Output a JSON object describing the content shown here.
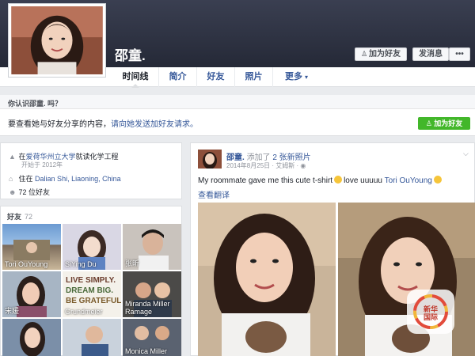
{
  "profile": {
    "name": "邵童."
  },
  "cover_actions": {
    "add_friend": "加为好友",
    "message": "发消息",
    "more": "•••"
  },
  "tabs": [
    {
      "label": "时间线"
    },
    {
      "label": "简介"
    },
    {
      "label": "好友"
    },
    {
      "label": "照片"
    },
    {
      "label": "更多"
    }
  ],
  "know_banner": "你认识邵童. 吗？",
  "share_prompt": {
    "text": "要查看她与好友分享的内容，",
    "link": "请向她发送加好友请求。",
    "button": "加为好友"
  },
  "intro": {
    "study_prefix": "在",
    "school": "爱荷华州立大学",
    "study_suffix": "就读化学工程",
    "since": "开始于 2012年",
    "lives_prefix": "住在",
    "city": "Dalian Shi, Liaoning, China",
    "friends_count": "72 位好友"
  },
  "friends": {
    "title": "好友",
    "count": "72",
    "tiles": [
      {
        "name": "Tori OuYoung"
      },
      {
        "name": "SiYing Du"
      },
      {
        "name": "张昕"
      },
      {
        "name": "宋媛"
      },
      {
        "name": "Grundmeier"
      },
      {
        "name": "Miranda Miller Ramage"
      },
      {
        "name": ""
      },
      {
        "name": ""
      },
      {
        "name": "Monica Miller"
      }
    ]
  },
  "post": {
    "author": "邵童.",
    "action": "添加了",
    "photos_link": "2 张新照片",
    "date": "2014年8月25日 · 艾姆斯 ·",
    "text_before": "My roommate gave me this cute t-shirt",
    "text_middle": "love uuuuu",
    "mention": "Tori OuYoung",
    "translate": "查看翻译"
  },
  "watermark": {
    "line1": "新华",
    "line2": "国际"
  },
  "colors": {
    "link": "#365899",
    "green": "#42b72a",
    "cover": "#2b2f3d",
    "background": "#e9ebee"
  }
}
